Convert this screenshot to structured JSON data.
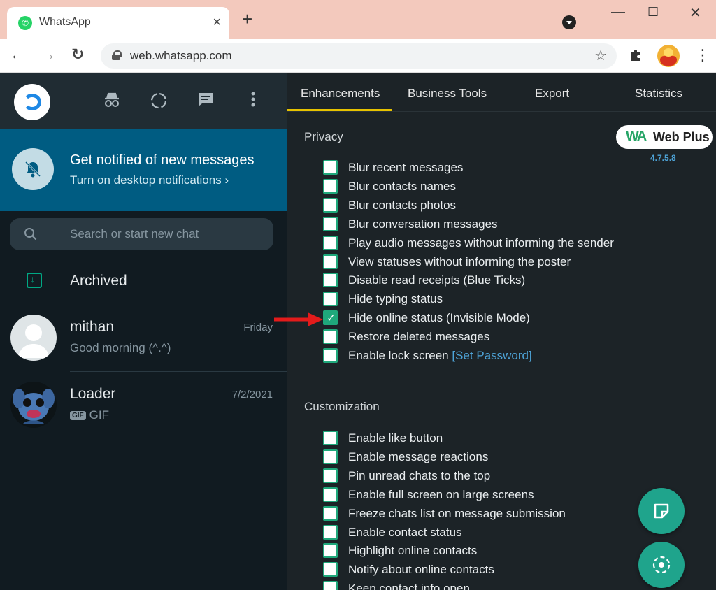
{
  "browser": {
    "tab_title": "WhatsApp",
    "tab_close": "×",
    "new_tab": "+",
    "url": "web.whatsapp.com",
    "back": "←",
    "forward": "→",
    "reload": "↻",
    "star": "☆",
    "minimize": "—",
    "maximize": "☐",
    "close": "✕",
    "menu": "⋮"
  },
  "left_pane": {
    "notification": {
      "title": "Get notified of new messages",
      "subtitle": "Turn on desktop notifications ›"
    },
    "search": {
      "placeholder": "Search or start new chat"
    },
    "archived_label": "Archived",
    "chats": [
      {
        "name": "mithan",
        "time": "Friday",
        "message": "Good morning (^.^)"
      },
      {
        "name": "Loader",
        "time": "7/2/2021",
        "badge": "GIF",
        "message": "GIF"
      }
    ]
  },
  "right_pane": {
    "tabs": [
      "Enhancements",
      "Business Tools",
      "Export",
      "Statistics"
    ],
    "active_tab": "Enhancements",
    "brand": {
      "logo": "WA",
      "name": "Web Plus",
      "version": "4.7.5.8"
    },
    "privacy": {
      "title": "Privacy",
      "options": [
        {
          "label": "Blur recent messages",
          "checked": false
        },
        {
          "label": "Blur contacts names",
          "checked": false
        },
        {
          "label": "Blur contacts photos",
          "checked": false
        },
        {
          "label": "Blur conversation messages",
          "checked": false
        },
        {
          "label": "Play audio messages without informing the sender",
          "checked": false
        },
        {
          "label": "View statuses without informing the poster",
          "checked": false
        },
        {
          "label": "Disable read receipts (Blue Ticks)",
          "checked": false
        },
        {
          "label": "Hide typing status",
          "checked": false
        },
        {
          "label": "Hide online status (Invisible Mode)",
          "checked": true
        },
        {
          "label": "Restore deleted messages",
          "checked": false
        },
        {
          "label": "Enable lock screen",
          "link": "[Set Password]",
          "checked": false
        }
      ]
    },
    "customization": {
      "title": "Customization",
      "options": [
        {
          "label": "Enable like button",
          "checked": false
        },
        {
          "label": "Enable message reactions",
          "checked": false
        },
        {
          "label": "Pin unread chats to the top",
          "checked": false
        },
        {
          "label": "Enable full screen on large screens",
          "checked": false
        },
        {
          "label": "Freeze chats list on message submission",
          "checked": false
        },
        {
          "label": "Enable contact status",
          "checked": false
        },
        {
          "label": "Highlight online contacts",
          "checked": false
        },
        {
          "label": "Notify about online contacts",
          "checked": false
        },
        {
          "label": "Keep contact info open",
          "checked": false
        }
      ]
    }
  },
  "colors": {
    "wa_dark": "#111b21",
    "notify_banner": "#005c82",
    "accent_green": "#1fa87b",
    "tab_underline": "#e6c200",
    "link_blue": "#4ea4d8",
    "arrow_red": "#e31b1b"
  }
}
